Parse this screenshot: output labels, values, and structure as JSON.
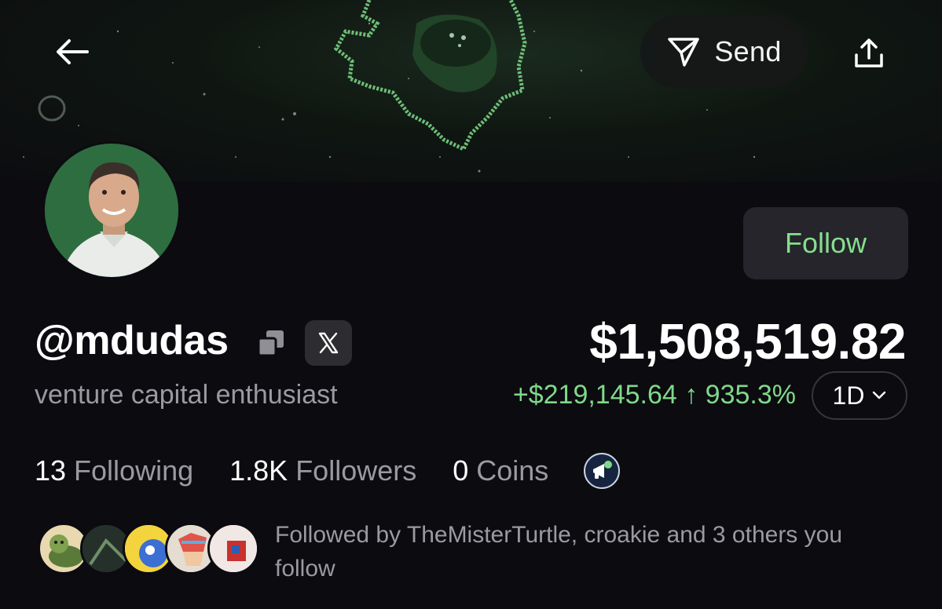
{
  "header": {
    "back_icon": "arrow-left-icon",
    "send_label": "Send",
    "send_icon": "paper-plane-icon",
    "share_icon": "share-upload-icon"
  },
  "profile": {
    "follow_label": "Follow",
    "handle": "@mdudas",
    "bio": "venture capital enthusiast",
    "x_label": "𝕏"
  },
  "portfolio": {
    "balance": "$1,508,519.82",
    "change": "+$219,145.64 ↑ 935.3%",
    "period": "1D"
  },
  "stats": [
    {
      "value": "13",
      "label": "Following"
    },
    {
      "value": "1.8K",
      "label": "Followers"
    },
    {
      "value": "0",
      "label": "Coins"
    }
  ],
  "followed_by": {
    "text": "Followed by TheMisterTurtle, croakie and 3 others you follow"
  },
  "colors": {
    "background": "#0c0b10",
    "accent_green": "#86de8e",
    "muted_text": "#9a9aa0",
    "button_bg": "#25252b"
  }
}
